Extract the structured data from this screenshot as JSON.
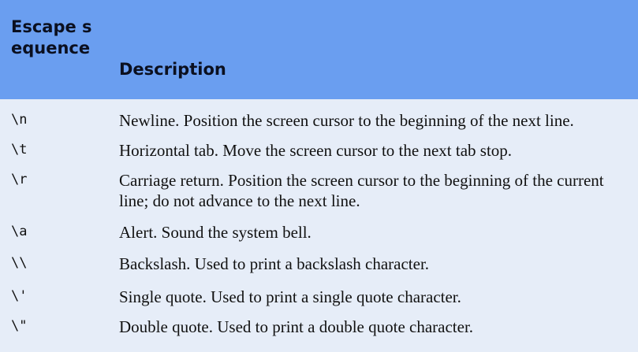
{
  "header": {
    "col1": "Escape sequence",
    "col2": "Description"
  },
  "rows": [
    {
      "seq": "\\n",
      "desc": "Newline. Position the screen cursor to the beginning of the next line."
    },
    {
      "seq": "\\t",
      "desc": "Horizontal tab. Move the screen cursor to the next tab stop."
    },
    {
      "seq": "\\r",
      "desc": "Carriage return. Position the screen cursor to the beginning of the current line; do not advance to the next line."
    },
    {
      "seq": "\\a",
      "desc": "Alert. Sound the system bell."
    },
    {
      "seq": "\\\\",
      "desc": "Backslash. Used to print a backslash character."
    },
    {
      "seq": "\\'",
      "desc": "Single quote. Used to print a single quote character."
    },
    {
      "seq": "\\\"",
      "desc": "Double quote. Used to print a double quote character."
    }
  ]
}
